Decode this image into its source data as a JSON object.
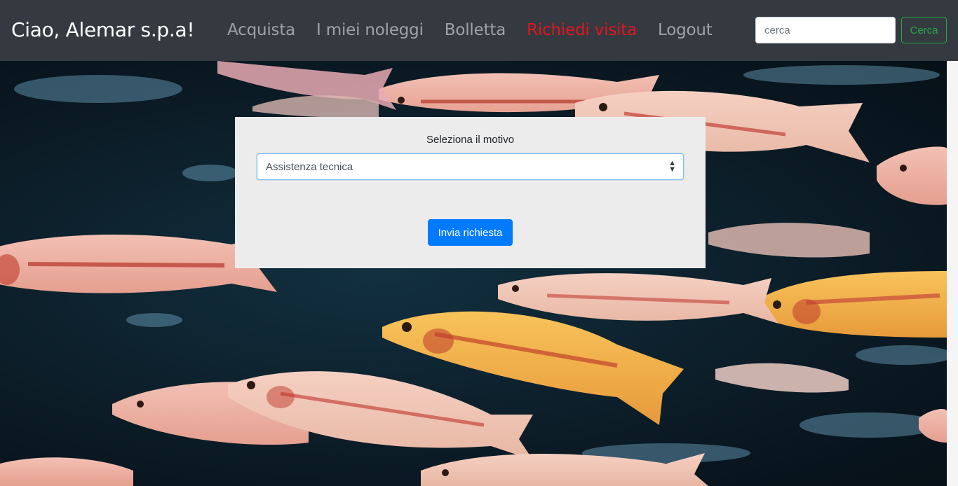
{
  "navbar": {
    "brand": "Ciao, Alemar s.p.a!",
    "links": [
      {
        "label": "Acquista"
      },
      {
        "label": "I miei noleggi"
      },
      {
        "label": "Bolletta"
      },
      {
        "label": "Richiedi visita",
        "active": true
      },
      {
        "label": "Logout"
      }
    ],
    "search": {
      "placeholder": "cerca",
      "button_label": "Cerca"
    }
  },
  "form": {
    "label": "Seleziona il motivo",
    "selected_reason": "Assistenza tecnica",
    "submit_label": "Invia richiesta"
  },
  "colors": {
    "navbar_bg": "#343a40",
    "active_link": "#e3161e",
    "primary": "#007bff",
    "success": "#28a745",
    "panel_bg": "#ececec"
  },
  "hero": {
    "background_icon": "fish-school-photo"
  }
}
